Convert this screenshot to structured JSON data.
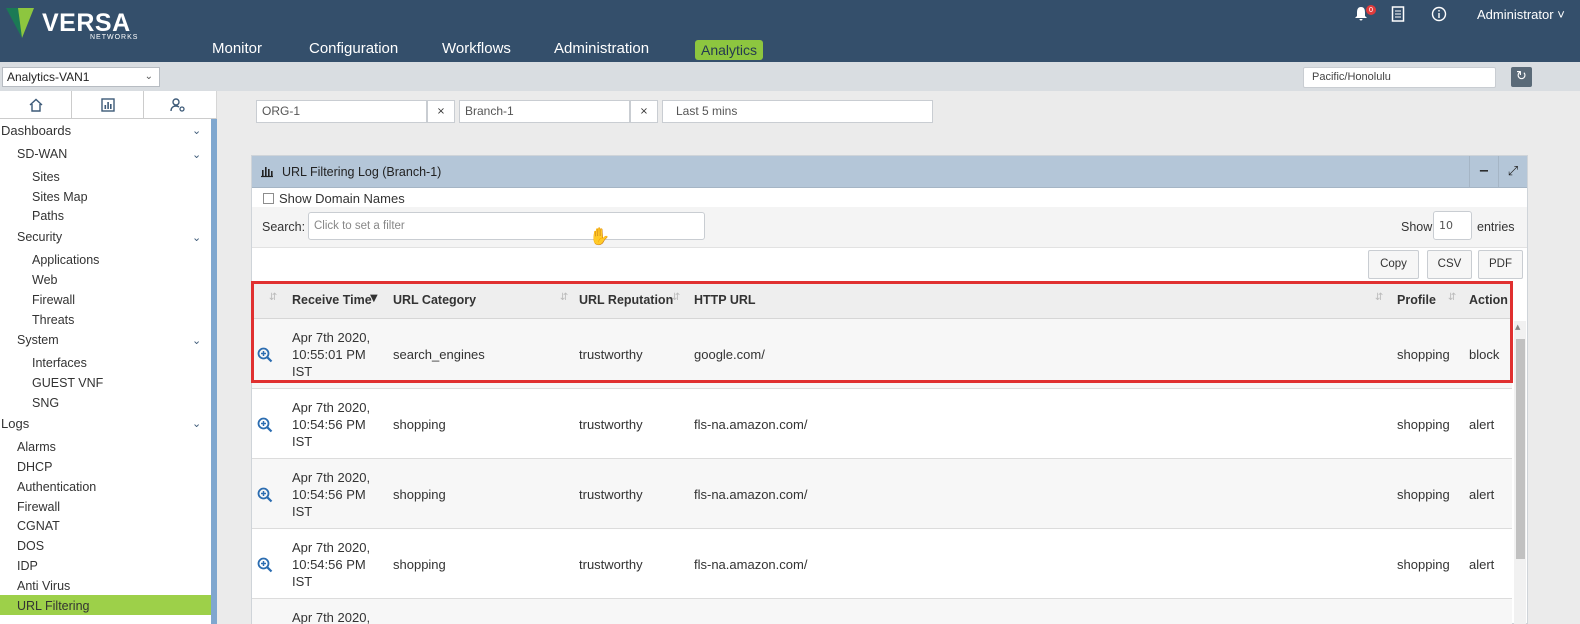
{
  "brand": {
    "name": "VERSA",
    "sub": "NETWORKS",
    "colors": {
      "logo_dark": "#1b7a55",
      "logo_light": "#8dc63f"
    }
  },
  "topnav": {
    "items": [
      "Monitor",
      "Configuration",
      "Workflows",
      "Administration",
      "Analytics"
    ],
    "active": "Analytics",
    "notification_count": "0",
    "user": "Administrator ˅",
    "icons": [
      "bell-icon",
      "document-icon",
      "info-icon"
    ]
  },
  "subbar": {
    "appliance": "Analytics-VAN1",
    "timezone": "Pacific/Honolulu",
    "refresh_icon": "refresh-icon"
  },
  "sidebar": {
    "tabs": [
      "home-icon",
      "chart-icon",
      "user-settings-icon"
    ],
    "sections": {
      "dashboards": "Dashboards",
      "sdwan": "SD-WAN",
      "sdwan_items": [
        "Sites",
        "Sites Map",
        "Paths"
      ],
      "security": "Security",
      "security_items": [
        "Applications",
        "Web",
        "Firewall",
        "Threats"
      ],
      "system": "System",
      "system_items": [
        "Interfaces",
        "GUEST VNF",
        "SNG"
      ],
      "logs": "Logs",
      "logs_items": [
        "Alarms",
        "DHCP",
        "Authentication",
        "Firewall",
        "CGNAT",
        "DOS",
        "IDP",
        "Anti Virus",
        "URL Filtering"
      ]
    },
    "active_item": "URL Filtering"
  },
  "filters": {
    "org": "ORG-1",
    "branch": "Branch-1",
    "time_range": "Last 5 mins",
    "clear_label": "×"
  },
  "panel": {
    "title": "URL Filtering Log (Branch-1)",
    "minimize": "−",
    "expand": "⤢",
    "show_domain_names": "Show Domain Names",
    "search_label": "Search:",
    "search_placeholder": "Click to set a filter",
    "show_label": "Show",
    "show_value": "10",
    "entries_label": "entries",
    "export_buttons": [
      "Copy",
      "CSV",
      "PDF"
    ]
  },
  "table": {
    "columns": [
      "Receive Time",
      "URL Category",
      "URL Reputation",
      "HTTP URL",
      "Profile",
      "Action"
    ],
    "rows": [
      {
        "time": "Apr 7th 2020, 10:55:01 PM IST",
        "category": "search_engines",
        "reputation": "trustworthy",
        "url": "google.com/",
        "profile": "shopping",
        "action": "block"
      },
      {
        "time": "Apr 7th 2020, 10:54:56 PM IST",
        "category": "shopping",
        "reputation": "trustworthy",
        "url": "fls-na.amazon.com/",
        "profile": "shopping",
        "action": "alert"
      },
      {
        "time": "Apr 7th 2020, 10:54:56 PM IST",
        "category": "shopping",
        "reputation": "trustworthy",
        "url": "fls-na.amazon.com/",
        "profile": "shopping",
        "action": "alert"
      },
      {
        "time": "Apr 7th 2020, 10:54:56 PM IST",
        "category": "shopping",
        "reputation": "trustworthy",
        "url": "fls-na.amazon.com/",
        "profile": "shopping",
        "action": "alert"
      },
      {
        "time": "Apr 7th 2020,",
        "category": "",
        "reputation": "",
        "url": "",
        "profile": "",
        "action": ""
      }
    ]
  },
  "colors": {
    "header_bg": "#344f6b",
    "accent_green": "#8dc63f",
    "highlight_border": "#e03030",
    "panel_header": "#b4c6d8"
  }
}
